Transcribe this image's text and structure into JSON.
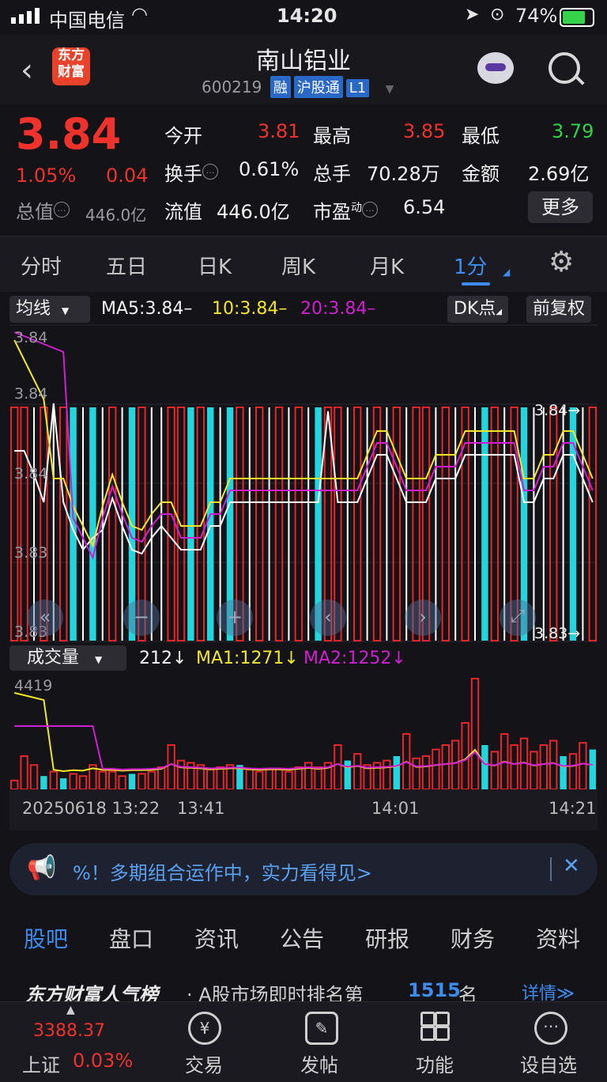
{
  "status": {
    "carrier": "中国电信",
    "time": "14:20",
    "battery": "74%"
  },
  "header": {
    "logo": "东方财富",
    "name": "南山铝业",
    "code": "600219",
    "tags": [
      "融",
      "沪股通",
      "L1"
    ]
  },
  "quote": {
    "price": "3.84",
    "change_pct": "1.05%",
    "change": "0.04",
    "open_label": "今开",
    "open": "3.81",
    "high_label": "最高",
    "high": "3.85",
    "low_label": "最低",
    "low": "3.79",
    "turnover_label": "换手",
    "turnover": "0.61%",
    "volume_label": "总手",
    "volume": "70.28万",
    "amount_label": "金额",
    "amount": "2.69亿",
    "mktcap_label": "总值",
    "mktcap": "446.0亿",
    "float_label": "流值",
    "float": "446.0亿",
    "pe_label": "市盈",
    "pe_sup": "动",
    "pe": "6.54",
    "more": "更多"
  },
  "tabs": [
    "分时",
    "五日",
    "日K",
    "周K",
    "月K",
    "1分"
  ],
  "chart": {
    "ma_select": "均线",
    "ma5": "MA5:3.84–",
    "ma10": "10:3.84–",
    "ma20": "20:3.84–",
    "dk": "DK点",
    "fq": "前复权",
    "y_labels": [
      "3.84",
      "3.84",
      "3.84",
      "3.83",
      "3.83"
    ],
    "hi_label": "3.84→",
    "lo_label": "3.83→",
    "vol_select": "成交量",
    "vol": "212↓",
    "vol_ma1": "MA1:1271↓",
    "vol_ma2": "MA2:1252↓",
    "vol_max": "4419",
    "x_labels": [
      "20250618 13:22",
      "13:41",
      "14:01",
      "14:21"
    ],
    "colors": {
      "up": "#e8262a",
      "down": "#22d6e0",
      "ma5": "#ffffff",
      "ma10": "#f2e62a",
      "ma20": "#d21ed2"
    }
  },
  "notice": {
    "text": "%！多期组合运作中，实力看得见>"
  },
  "news_tabs": [
    "股吧",
    "盘口",
    "资讯",
    "公告",
    "研报",
    "财务",
    "资料"
  ],
  "rank": {
    "brand": "东方财富人气榜",
    "text": "· A股市场即时排名第",
    "rank": "1515",
    "suffix": "名",
    "detail": "详情≫"
  },
  "bottom": {
    "index_value": "3388.37",
    "index_name": "上证",
    "index_pct": "0.03%",
    "items": [
      "交易",
      "发帖",
      "功能",
      "设自选"
    ]
  }
}
